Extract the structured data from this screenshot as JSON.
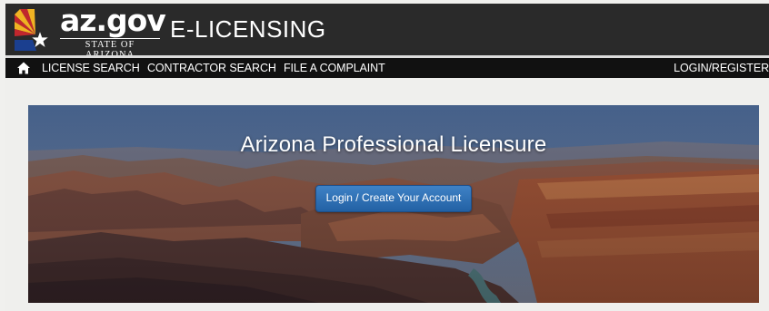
{
  "header": {
    "logo_text": "az.gov",
    "logo_subtitle": "STATE OF ARIZONA",
    "app_title": "E-LICENSING"
  },
  "nav": {
    "home_icon": "home-icon",
    "items": [
      {
        "label": "LICENSE SEARCH"
      },
      {
        "label": "CONTRACTOR SEARCH"
      },
      {
        "label": "FILE A COMPLAINT"
      }
    ],
    "login_label": "LOGIN/REGISTER"
  },
  "hero": {
    "title": "Arizona Professional Licensure",
    "button_label": "Login / Create Your Account",
    "background": "grand-canyon-landscape"
  },
  "colors": {
    "header_bg": "#2a2a2a",
    "nav_bg": "#111111",
    "button_blue": "#2d6fb3",
    "page_bg": "#efefed"
  }
}
